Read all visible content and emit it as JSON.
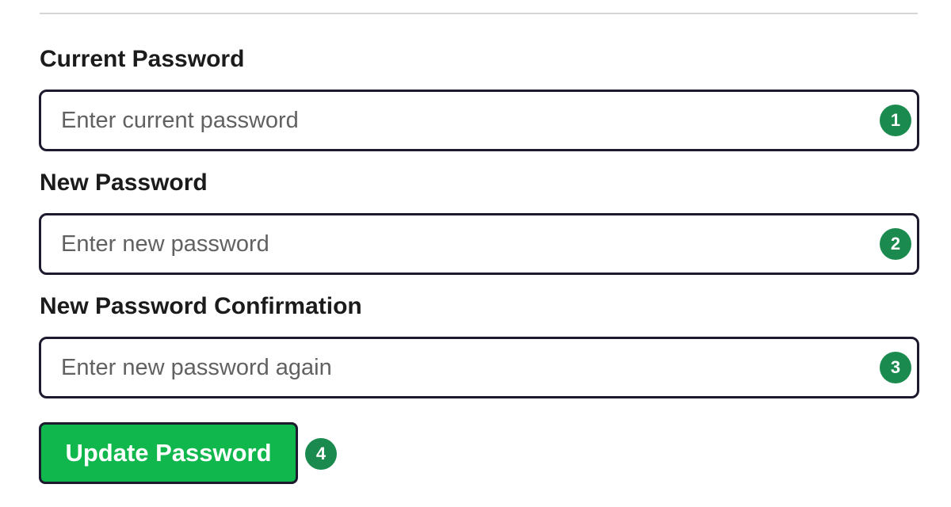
{
  "form": {
    "current_password": {
      "label": "Current Password",
      "placeholder": "Enter current password",
      "value": "",
      "badge": "1"
    },
    "new_password": {
      "label": "New Password",
      "placeholder": "Enter new password",
      "value": "",
      "badge": "2"
    },
    "new_password_confirmation": {
      "label": "New Password Confirmation",
      "placeholder": "Enter new password again",
      "value": "",
      "badge": "3"
    },
    "submit": {
      "label": "Update Password",
      "badge": "4"
    }
  },
  "colors": {
    "button_bg": "#0fb74c",
    "badge_bg": "#1a8a4f",
    "input_border": "#1c1a2e",
    "divider": "#d5d5d5"
  }
}
